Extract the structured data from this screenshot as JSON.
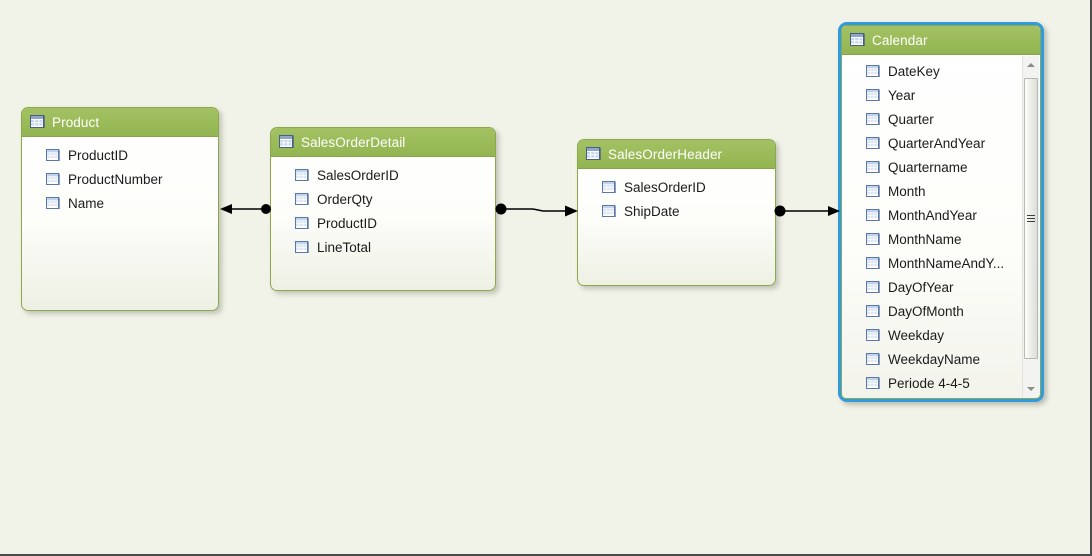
{
  "diagram": {
    "title": "Data model diagram view",
    "background_color": "#f1f2e8",
    "header_color": "#9bbb59",
    "selection_color": "#2e9be2",
    "border_color": "#8ba84a",
    "table_icon": "table-grid-icon",
    "field_icon": "field-grid-icon"
  },
  "tables": [
    {
      "name": "Product",
      "fields": [
        "ProductID",
        "ProductNumber",
        "Name"
      ]
    },
    {
      "name": "SalesOrderDetail",
      "fields": [
        "SalesOrderID",
        "OrderQty",
        "ProductID",
        "LineTotal"
      ]
    },
    {
      "name": "SalesOrderHeader",
      "fields": [
        "SalesOrderID",
        "ShipDate"
      ]
    },
    {
      "name": "Calendar",
      "selected": true,
      "fields": [
        "DateKey",
        "Year",
        "Quarter",
        "QuarterAndYear",
        "Quartername",
        "Month",
        "MonthAndYear",
        "MonthName",
        "MonthNameAndY...",
        "DayOfYear",
        "DayOfMonth",
        "Weekday",
        "WeekdayName",
        "Periode 4-4-5"
      ],
      "scrollbar": {
        "up_arrow": "scroll-up-arrow-icon",
        "down_arrow": "scroll-down-arrow-icon",
        "thumb": "scrollbar-thumb"
      }
    }
  ],
  "relationships": [
    {
      "from": "SalesOrderDetail",
      "to": "Product",
      "direction": "left",
      "from_marker": "dot",
      "to_marker": "arrow"
    },
    {
      "from": "SalesOrderDetail",
      "to": "SalesOrderHeader",
      "direction": "right",
      "from_marker": "dot",
      "to_marker": "arrow"
    },
    {
      "from": "SalesOrderHeader",
      "to": "Calendar",
      "direction": "right",
      "from_marker": "dot",
      "to_marker": "arrow"
    }
  ]
}
